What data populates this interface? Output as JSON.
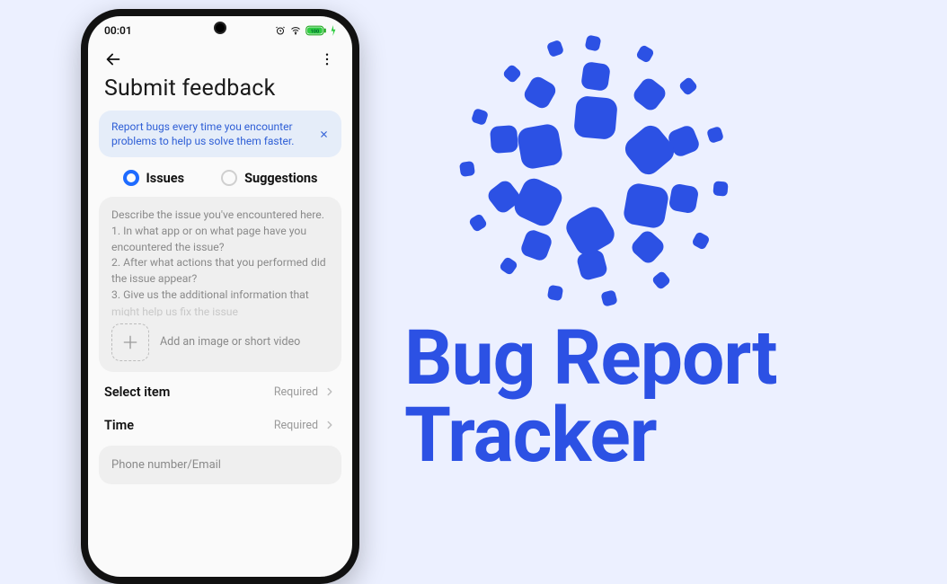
{
  "statusbar": {
    "time": "00:01"
  },
  "page": {
    "title": "Submit feedback"
  },
  "banner": {
    "text": "Report bugs every time you encounter problems to help us solve them faster."
  },
  "tabs": {
    "issues": {
      "label": "Issues",
      "selected": true
    },
    "suggestions": {
      "label": "Suggestions",
      "selected": false
    }
  },
  "description": {
    "placeholder": "Describe the issue you've encountered here.\n1. In what app or on what page have you encountered the issue?\n2. After what actions that you performed did the issue appear?\n3. Give us the additional information that",
    "placeholder_cut": "might help us fix the issue"
  },
  "add_media": {
    "label": "Add an image or short video"
  },
  "rows": {
    "select_item": {
      "label": "Select item",
      "hint": "Required"
    },
    "time": {
      "label": "Time",
      "hint": "Required"
    }
  },
  "contact": {
    "placeholder": "Phone number/Email"
  },
  "brand": {
    "title_line1": "Bug Report",
    "title_line2": "Tracker"
  },
  "colors": {
    "accent": "#2c51e4",
    "bg": "#ecf0ff"
  }
}
